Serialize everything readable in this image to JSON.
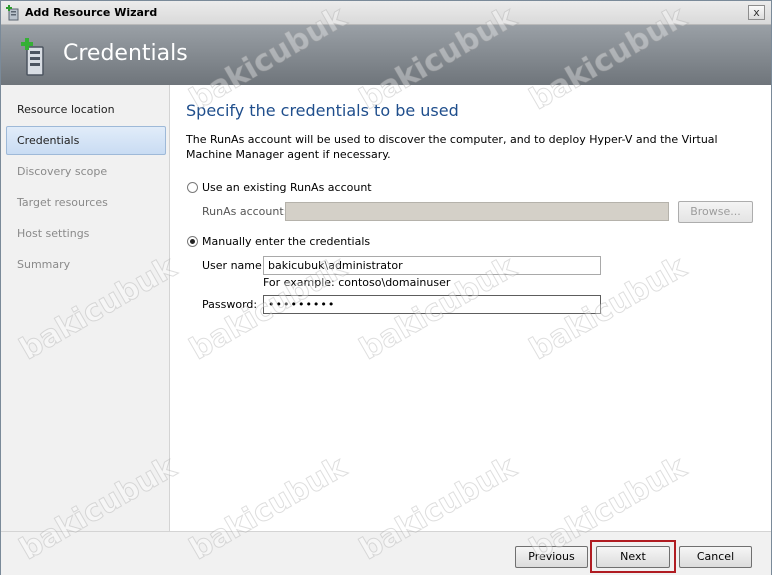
{
  "window": {
    "title": "Add Resource Wizard",
    "close_glyph": "x"
  },
  "banner": {
    "heading": "Credentials",
    "icon": "server-add-icon"
  },
  "sidebar": {
    "items": [
      {
        "label": "Resource location",
        "state": "normal"
      },
      {
        "label": "Credentials",
        "state": "active"
      },
      {
        "label": "Discovery scope",
        "state": "disabled"
      },
      {
        "label": "Target resources",
        "state": "disabled"
      },
      {
        "label": "Host settings",
        "state": "disabled"
      },
      {
        "label": "Summary",
        "state": "disabled"
      }
    ]
  },
  "main": {
    "title": "Specify the credentials to be used",
    "description": "The RunAs account will be used to discover the computer, and to deploy Hyper-V and the Virtual Machine Manager agent if necessary.",
    "option_existing": {
      "label": "Use an existing RunAs account",
      "checked": false,
      "runas_label": "RunAs account:",
      "runas_value": "",
      "browse_label": "Browse..."
    },
    "option_manual": {
      "label": "Manually enter the credentials",
      "checked": true,
      "username_label": "User name:",
      "username_value": "bakicubuk\\administrator",
      "example_text": "For example: contoso\\domainuser",
      "password_label": "Password:",
      "password_value": "•••••••••"
    }
  },
  "footer": {
    "previous_label": "Previous",
    "next_label": "Next",
    "cancel_label": "Cancel",
    "highlight_color": "#b01c22"
  },
  "watermark": {
    "text": "bakicubuk"
  },
  "colors": {
    "title_blue": "#1f4e8c",
    "banner_gray": "#80868c",
    "active_nav": "#c9dcf3"
  }
}
